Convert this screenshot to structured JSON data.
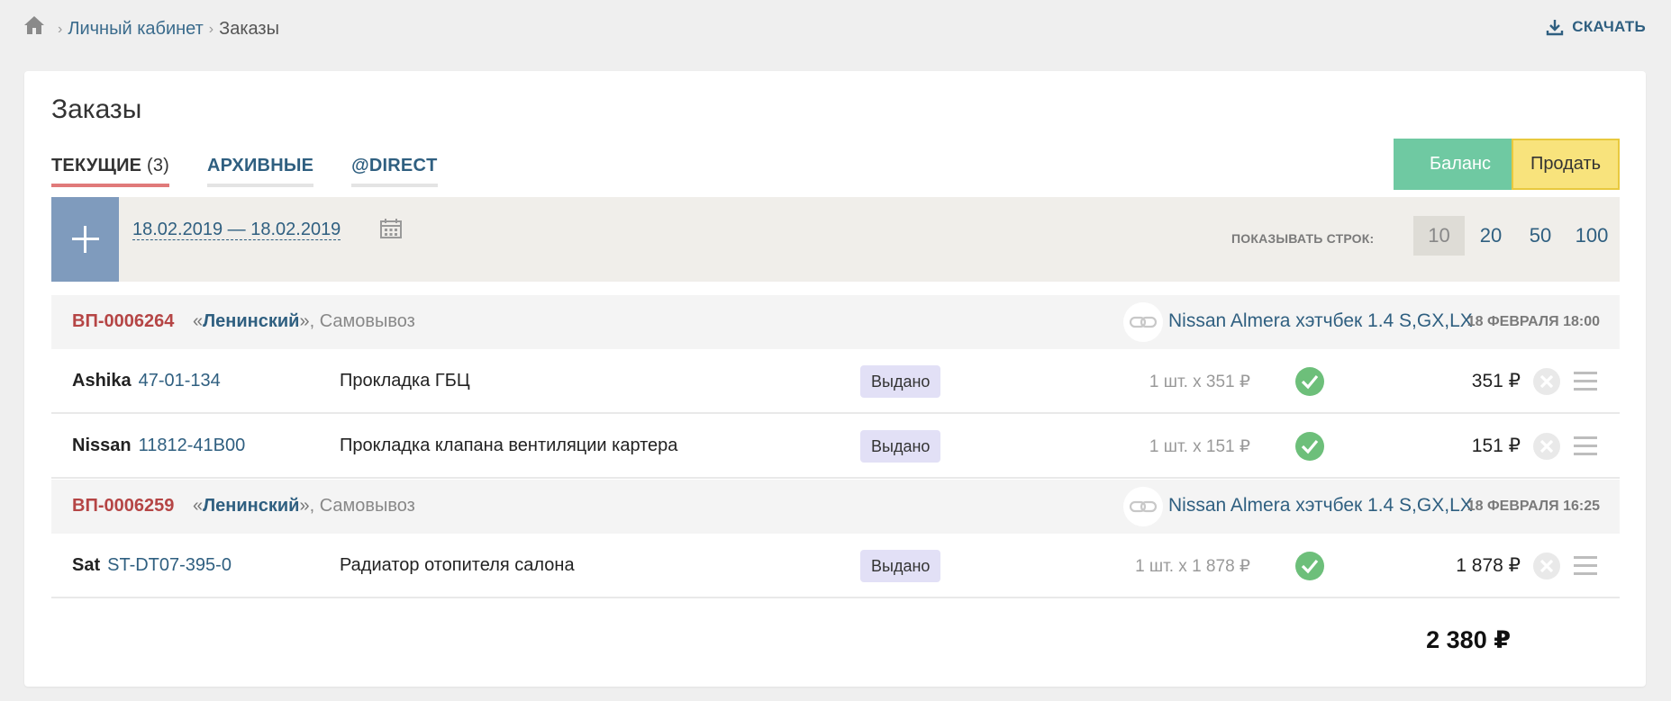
{
  "breadcrumb": {
    "items": [
      {
        "label": "Личный кабинет"
      },
      {
        "label": "Заказы"
      }
    ]
  },
  "download_label": "СКАЧАТЬ",
  "page_title": "Заказы",
  "tabs": [
    {
      "label": "ТЕКУЩИЕ",
      "count": "(3)",
      "active": true
    },
    {
      "label": "АРХИВНЫЕ",
      "active": false
    },
    {
      "label": "@DIRECT",
      "active": false
    }
  ],
  "buttons": {
    "balance": "Баланс",
    "sell": "Продать"
  },
  "filter": {
    "date_range": "18.02.2019 — 18.02.2019",
    "rows_label": "ПОКАЗЫВАТЬ СТРОК:",
    "rows_options": [
      "10",
      "20",
      "50",
      "100"
    ],
    "rows_selected": "10"
  },
  "orders": [
    {
      "id": "ВП-0006264",
      "store": "Ленинский",
      "delivery": "Самовывоз",
      "car": "Nissan Almera хэтчбек 1.4 S,GX,LX",
      "date": "18 ФЕВРАЛЯ 18:00",
      "items": [
        {
          "brand": "Ashika",
          "article": "47-01-134",
          "name": "Прокладка ГБЦ",
          "status": "Выдано",
          "qty": "1 шт. x 351 ₽",
          "price": "351 ₽"
        },
        {
          "brand": "Nissan",
          "article": "11812-41B00",
          "name": "Прокладка клапана вентиляции картера",
          "status": "Выдано",
          "qty": "1 шт. x 151 ₽",
          "price": "151 ₽"
        }
      ]
    },
    {
      "id": "ВП-0006259",
      "store": "Ленинский",
      "delivery": "Самовывоз",
      "car": "Nissan Almera хэтчбек 1.4 S,GX,LX",
      "date": "18 ФЕВРАЛЯ 16:25",
      "items": [
        {
          "brand": "Sat",
          "article": "ST-DT07-395-0",
          "name": "Радиатор отопителя салона",
          "status": "Выдано",
          "qty": "1 шт. x 1 878 ₽",
          "price": "1 878 ₽"
        }
      ]
    }
  ],
  "total": "2 380 ₽",
  "colors": {
    "link": "#2f5f80",
    "order_id": "#b54545",
    "balance_button": "#6fc9a2",
    "sell_button": "#f8e37c",
    "add_button": "#7f9bbd",
    "status_ok": "#6dbf7a",
    "active_tab_underline": "#e07a7a"
  },
  "icons": {
    "home": "home-icon",
    "download": "download-icon",
    "calendar": "calendar-icon",
    "link": "link-icon",
    "check": "check-circle-icon",
    "cancel": "cancel-circle-icon",
    "menu": "menu-icon"
  }
}
